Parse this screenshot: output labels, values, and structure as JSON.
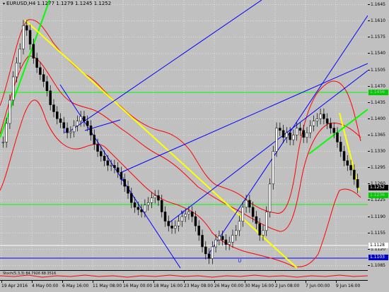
{
  "window": {
    "symbol_icon": "chart-window-icon",
    "title": "EURUSD,H4  1.1277 1.1279 1.1245 1.1252"
  },
  "price_axis": {
    "ticks": [
      "1.1645",
      "1.1610",
      "1.1575",
      "1.1540",
      "1.1505",
      "1.1470",
      "1.1435",
      "1.1400",
      "1.1365",
      "1.1330",
      "1.1295",
      "1.1260",
      "1.1225",
      "1.1190",
      "1.1155",
      "1.1120",
      "1.1085"
    ],
    "badges": [
      {
        "label": "1.1456",
        "value": 1.1456,
        "color": "#00cc00",
        "text_color": "#c0c0c0"
      },
      {
        "label": "1.1252",
        "value": 1.1252,
        "color": "#000000",
        "text_color": "#ffffff"
      },
      {
        "label": "1.1236",
        "value": 1.1236,
        "color": "#00cc00",
        "text_color": "#c0c0c0"
      },
      {
        "label": "1.1128",
        "value": 1.1128,
        "color": "#ffffff",
        "text_color": "#000000"
      },
      {
        "label": "1.1103",
        "value": 1.1103,
        "color": "#0000cc",
        "text_color": "#ffffff"
      }
    ]
  },
  "time_axis": {
    "labels": [
      "19 Apr 2016",
      "4 May 00:00",
      "6 May 16:00",
      "11 May 08:00",
      "16 May 00:00",
      "18 May 16:00",
      "23 May 08:00",
      "26 May 00:00",
      "30 May 16:00",
      "2 Jun 08:00",
      "7 Jun 00:00",
      "9 Jun 16:00"
    ]
  },
  "indicator": {
    "label": "Stoch(5,3,3) 84.7926 68.3516"
  },
  "colors": {
    "background": "#c0c0c0",
    "candle": "#000000",
    "bollinger": "#ff0000",
    "trend_yellow": "#ffff00",
    "trend_blue": "#0000ff",
    "level_green": "#00ff00",
    "stoch": "#ff0000"
  },
  "chart_data": {
    "type": "candlestick",
    "title": "EURUSD,H4",
    "ylim": [
      1.1075,
      1.1655
    ],
    "x_labels": [
      "19 Apr 2016",
      "4 May 00:00",
      "6 May 16:00",
      "11 May 08:00",
      "16 May 00:00",
      "18 May 16:00",
      "23 May 08:00",
      "26 May 00:00",
      "30 May 16:00",
      "2 Jun 08:00",
      "7 Jun 00:00",
      "9 Jun 16:00"
    ],
    "close_path": [
      1.135,
      1.139,
      1.144,
      1.149,
      1.152,
      1.155,
      1.16,
      1.159,
      1.156,
      1.153,
      1.151,
      1.1495,
      1.148,
      1.146,
      1.143,
      1.1415,
      1.14,
      1.1392,
      1.138,
      1.137,
      1.1372,
      1.1385,
      1.1395,
      1.1405,
      1.1395,
      1.1385,
      1.1365,
      1.1345,
      1.133,
      1.132,
      1.131,
      1.13,
      1.13,
      1.1295,
      1.1285,
      1.127,
      1.1255,
      1.124,
      1.122,
      1.121,
      1.1205,
      1.12,
      1.1215,
      1.122,
      1.123,
      1.1235,
      1.1225,
      1.12,
      1.118,
      1.117,
      1.1165,
      1.117,
      1.118,
      1.119,
      1.1195,
      1.12,
      1.119,
      1.117,
      1.115,
      1.1125,
      1.111,
      1.11,
      1.1125,
      1.114,
      1.1148,
      1.114,
      1.113,
      1.1135,
      1.115,
      1.116,
      1.118,
      1.121,
      1.1225,
      1.121,
      1.119,
      1.1175,
      1.115,
      1.116,
      1.12,
      1.126,
      1.133,
      1.138,
      1.1375,
      1.136,
      1.137,
      1.1355,
      1.1365,
      1.138,
      1.1375,
      1.136,
      1.137,
      1.1385,
      1.1395,
      1.14,
      1.141,
      1.14,
      1.139,
      1.138,
      1.137,
      1.135,
      1.133,
      1.131,
      1.13,
      1.129,
      1.127,
      1.1252
    ],
    "horizontal_levels": [
      1.1456,
      1.1236,
      1.1128,
      1.1103
    ],
    "last_price": 1.1252,
    "stochastic": {
      "k": 84.7926,
      "d": 68.3516
    }
  }
}
